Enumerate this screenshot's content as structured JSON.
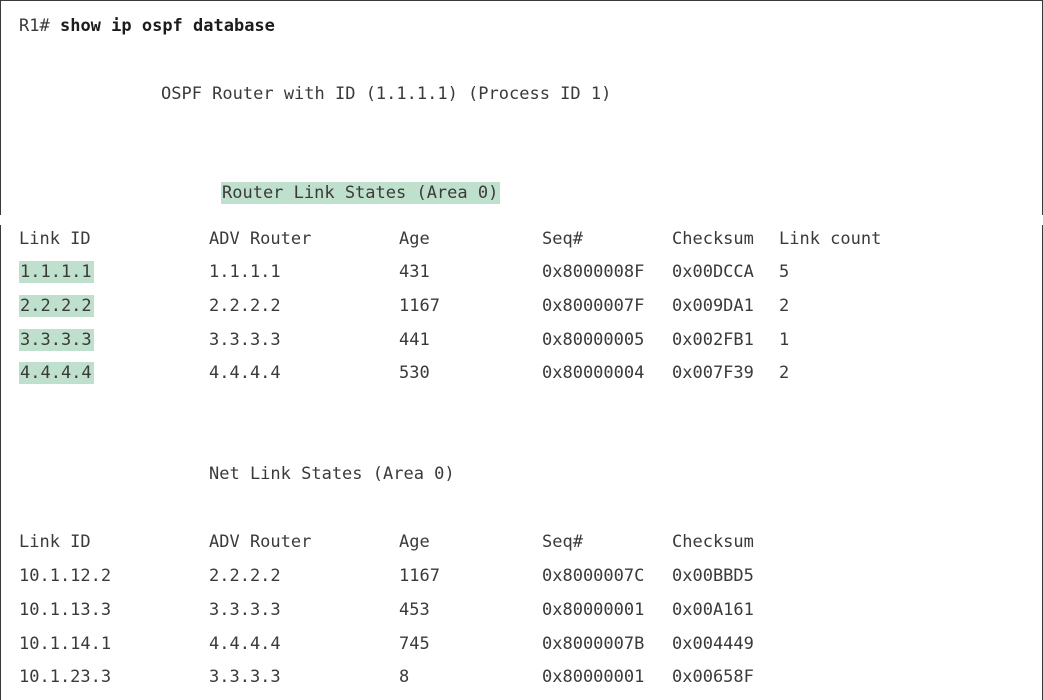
{
  "prompt": "R1#",
  "command": "show ip ospf database",
  "router_header": "OSPF Router with ID (1.1.1.1) (Process ID 1)",
  "router_link": {
    "title": "Router Link States (Area 0)",
    "headers": [
      "Link ID",
      "ADV Router",
      "Age",
      "Seq#",
      "Checksum",
      "Link count"
    ],
    "rows": [
      [
        "1.1.1.1",
        "1.1.1.1",
        "431",
        "0x8000008F",
        "0x00DCCA",
        "5"
      ],
      [
        "2.2.2.2",
        "2.2.2.2",
        "1167",
        "0x8000007F",
        "0x009DA1",
        "2"
      ],
      [
        "3.3.3.3",
        "3.3.3.3",
        "441",
        "0x80000005",
        "0x002FB1",
        "1"
      ],
      [
        "4.4.4.4",
        "4.4.4.4",
        "530",
        "0x80000004",
        "0x007F39",
        "2"
      ]
    ]
  },
  "net_link": {
    "title": "Net Link States (Area 0)",
    "headers": [
      "Link ID",
      "ADV Router",
      "Age",
      "Seq#",
      "Checksum"
    ],
    "rows": [
      [
        "10.1.12.2",
        "2.2.2.2",
        "1167",
        "0x8000007C",
        "0x00BBD5"
      ],
      [
        "10.1.13.3",
        "3.3.3.3",
        "453",
        "0x80000001",
        "0x00A161"
      ],
      [
        "10.1.14.1",
        "4.4.4.4",
        "745",
        "0x8000007B",
        "0x004449"
      ],
      [
        "10.1.23.3",
        "3.3.3.3",
        "8",
        "0x80000001",
        "0x00658F"
      ]
    ]
  },
  "highlight_color": "#bfe0cc"
}
